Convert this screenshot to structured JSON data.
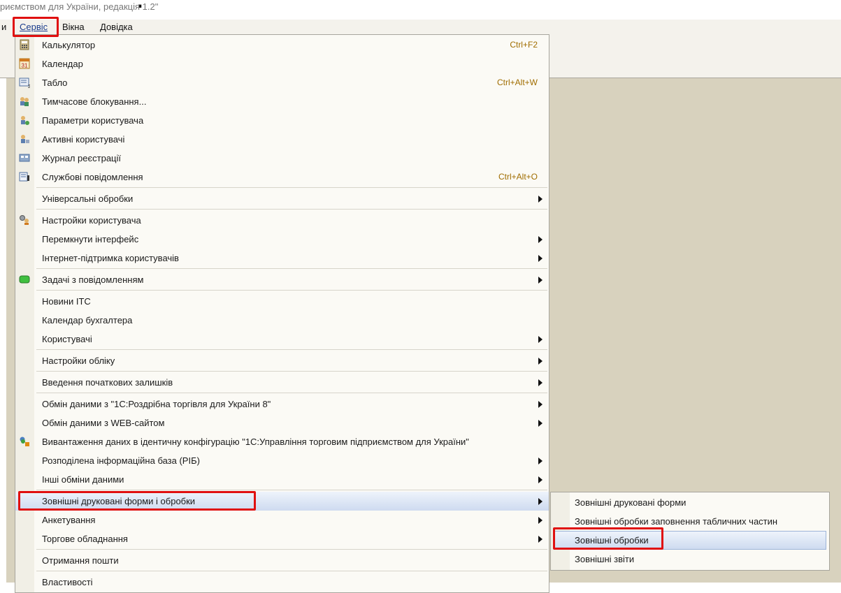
{
  "window": {
    "title_fragment": "риємством для України, редакція 1.2\""
  },
  "menubar": {
    "items": [
      "и",
      "Сервіс",
      "Вікна",
      "Довідка"
    ]
  },
  "menu": {
    "items": [
      {
        "label": "Калькулятор",
        "shortcut": "Ctrl+F2",
        "icon": "calculator-icon"
      },
      {
        "label": "Календар",
        "icon": "calendar-icon",
        "icon_text": "31"
      },
      {
        "label": "Табло",
        "shortcut": "Ctrl+Alt+W",
        "icon": "scoreboard-icon"
      },
      {
        "label": "Тимчасове блокування...",
        "icon": "users-lock-icon"
      },
      {
        "label": "Параметри користувача",
        "icon": "user-settings-icon"
      },
      {
        "label": "Активні користувачі",
        "icon": "active-users-icon"
      },
      {
        "label": "Журнал реєстрації",
        "icon": "log-icon"
      },
      {
        "label": "Службові повідомлення",
        "shortcut": "Ctrl+Alt+O",
        "icon": "messages-icon"
      },
      {
        "label": "Універсальні обробки",
        "submenu": true
      },
      {
        "label": "Настройки користувача",
        "icon": "user-gear-icon"
      },
      {
        "label": "Перемкнути інтерфейс",
        "submenu": true
      },
      {
        "label": "Інтернет-підтримка користувачів",
        "submenu": true
      },
      {
        "label": "Задачі з повідомленням",
        "submenu": true,
        "icon": "tasks-icon"
      },
      {
        "label": "Новини ІТС"
      },
      {
        "label": "Календар бухгалтера"
      },
      {
        "label": "Користувачі",
        "submenu": true
      },
      {
        "label": "Настройки обліку",
        "submenu": true
      },
      {
        "label": "Введення початкових залишків",
        "submenu": true
      },
      {
        "label": "Обмін даними з \"1С:Роздрібна торгівля для України 8\"",
        "submenu": true
      },
      {
        "label": "Обмін даними з WEB-сайтом",
        "submenu": true
      },
      {
        "label": "Вивантаження даних в ідентичну конфігурацію \"1С:Управління торговим підприємством для України\"",
        "icon": "export-icon"
      },
      {
        "label": "Розподілена інформаційна база (РІБ)",
        "submenu": true
      },
      {
        "label": "Інші обміни даними",
        "submenu": true
      },
      {
        "label": "Зовнішні друковані форми і обробки",
        "submenu": true,
        "highlighted": true
      },
      {
        "label": "Анкетування",
        "submenu": true
      },
      {
        "label": "Торгове обладнання",
        "submenu": true
      },
      {
        "label": "Отримання пошти"
      },
      {
        "label": "Властивості"
      }
    ]
  },
  "submenu": {
    "items": [
      {
        "label": "Зовнішні друковані форми"
      },
      {
        "label": "Зовнішні обробки заповнення табличних частин"
      },
      {
        "label": "Зовнішні обробки",
        "highlighted": true
      },
      {
        "label": "Зовнішні звіти"
      }
    ]
  },
  "colors": {
    "highlight_box": "#e01010",
    "workspace": "#d8d2be",
    "shortcut_text": "#a06d00"
  }
}
